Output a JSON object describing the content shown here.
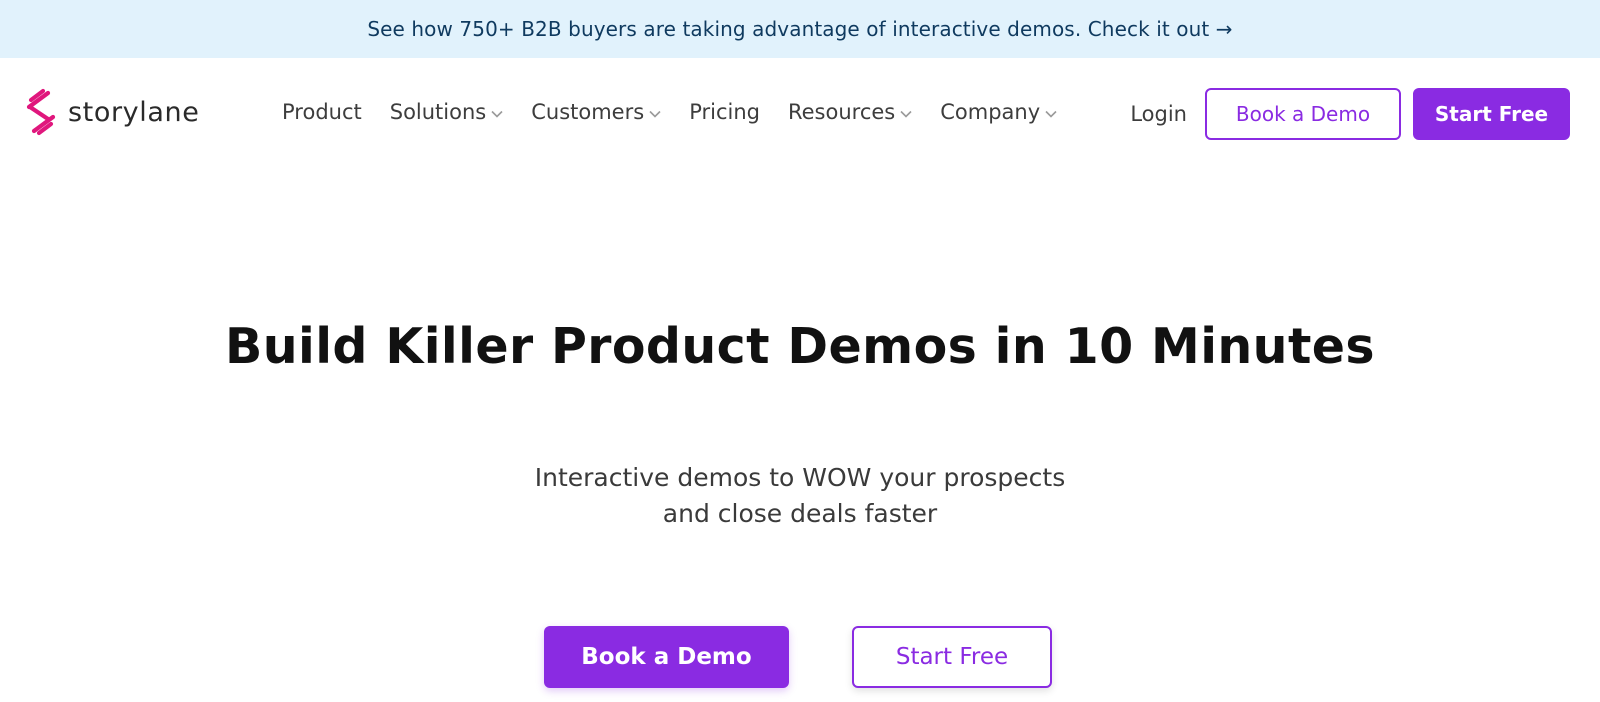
{
  "announcement": {
    "text": "See how 750+ B2B buyers are taking advantage of interactive demos. Check it out →"
  },
  "brand": {
    "name": "storylane",
    "icon": "storylane-logo-icon",
    "logo_color": "#e0177d"
  },
  "nav": {
    "items": [
      {
        "label": "Product",
        "has_dropdown": false
      },
      {
        "label": "Solutions",
        "has_dropdown": true
      },
      {
        "label": "Customers",
        "has_dropdown": true
      },
      {
        "label": "Pricing",
        "has_dropdown": false
      },
      {
        "label": "Resources",
        "has_dropdown": true
      },
      {
        "label": "Company",
        "has_dropdown": true
      }
    ],
    "login_label": "Login",
    "book_demo_label": "Book a Demo",
    "start_free_label": "Start Free"
  },
  "hero": {
    "title": "Build Killer Product Demos in 10 Minutes",
    "subtitle_line1": "Interactive demos to WOW your prospects",
    "subtitle_line2": "and close deals faster",
    "book_demo_label": "Book a Demo",
    "start_free_label": "Start Free"
  },
  "colors": {
    "accent": "#8a2be2",
    "announcement_bg": "#e1f2fc",
    "announcement_text": "#0f3a5f"
  }
}
